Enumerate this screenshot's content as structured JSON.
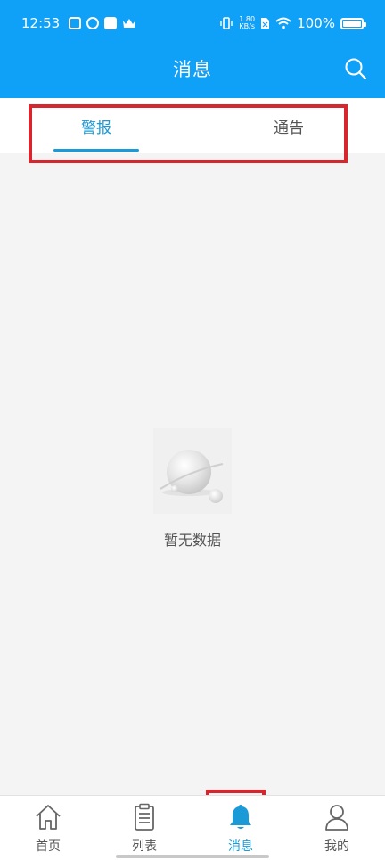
{
  "status_bar": {
    "time": "12:53",
    "net_speed": "1.80",
    "net_unit": "KB/s",
    "battery": "100%"
  },
  "header": {
    "title": "消息",
    "search_icon": "search-icon",
    "background_color": "#0fa0f7"
  },
  "tabs": [
    {
      "label": "警报",
      "active": true
    },
    {
      "label": "通告",
      "active": false
    }
  ],
  "empty_state": {
    "icon": "empty-planet-icon",
    "text": "暂无数据"
  },
  "bottom_nav": [
    {
      "label": "首页",
      "icon": "home-icon",
      "active": false
    },
    {
      "label": "列表",
      "icon": "clipboard-list-icon",
      "active": false
    },
    {
      "label": "消息",
      "icon": "bell-icon",
      "active": true
    },
    {
      "label": "我的",
      "icon": "user-icon",
      "active": false
    }
  ],
  "colors": {
    "accent": "#1a9ad7",
    "highlight_box": "#d8262f"
  }
}
